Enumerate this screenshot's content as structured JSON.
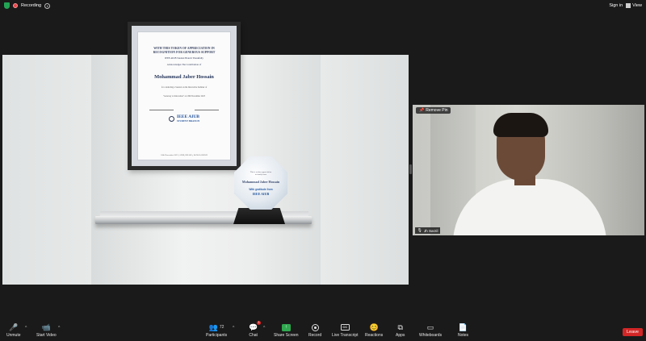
{
  "topbar": {
    "recording_label": "Recording",
    "sign_in_label": "Sign in",
    "view_label": "View"
  },
  "shared_screen": {
    "certificate": {
      "heading_line1": "WITH THIS TOKEN OF APPRECIATION IN",
      "heading_line2": "RECOGNITION FOR GENEROUS SUPPORT",
      "sub_line1": "IEEE AIUB Student Branch Thankfully",
      "sub_line2": "Acknowledges The Contribution of",
      "name": "Mohammad Jaber Hossain",
      "line1": "for conducting a Session on the Innovative Seminar of",
      "line2": "\"Gateway to Innovation\" on 18th November 2023",
      "org_name": "IEEE AIUB",
      "org_sub": "STUDENT BRANCH",
      "footer": "18th November 2023 | AIUB, DHAKA, BANGLADESH"
    },
    "trophy": {
      "small_line1": "This is a token appreciation",
      "small_line2": "to family from",
      "name": "Mohammad Jaber Hossain",
      "gratitude": "With gratitude from",
      "org": "IEEE AIUB"
    }
  },
  "participant_video": {
    "remove_pin_label": "Remove Pin",
    "name": "Jh Sarzil"
  },
  "toolbar": {
    "unmute": "Unmute",
    "start_video": "Start Video",
    "participants": "Participants",
    "participants_count": "72",
    "chat": "Chat",
    "chat_badge": "1",
    "share_screen": "Share Screen",
    "record": "Record",
    "live_transcript": "Live Transcript",
    "reactions": "Reactions",
    "apps": "Apps",
    "whiteboards": "Whiteboards",
    "notes": "Notes",
    "leave": "Leave",
    "cc_text": "CC"
  },
  "colors": {
    "background": "#1a1a1a",
    "leave_button": "#d32626",
    "share_button": "#2fa84f",
    "recording_dot": "#e5484d",
    "security_shield": "#23a455"
  }
}
